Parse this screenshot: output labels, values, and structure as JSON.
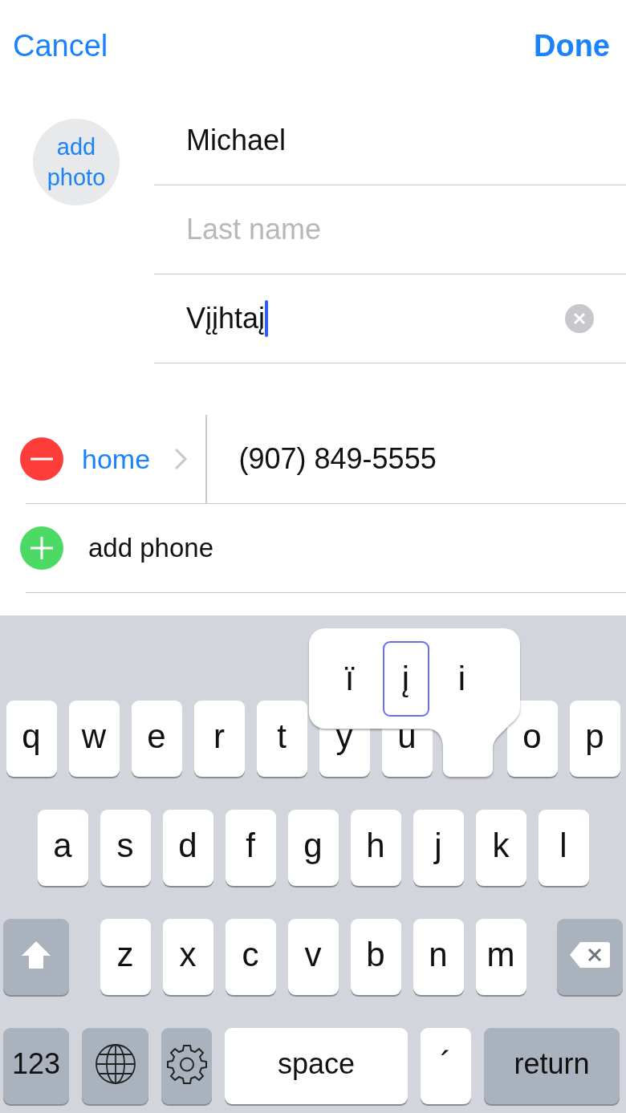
{
  "nav": {
    "cancel": "Cancel",
    "done": "Done"
  },
  "photo": {
    "label": "add photo"
  },
  "name_fields": [
    {
      "value": "Michael",
      "focused": false
    },
    {
      "placeholder": "Last name",
      "focused": false
    },
    {
      "value": "Vįįhtaį",
      "focused": true
    }
  ],
  "phones": [
    {
      "label": "home",
      "number": "(907) 849-5555"
    }
  ],
  "add_phone": "add phone",
  "keyboard": {
    "row_1": [
      {
        "kind": "letter",
        "label": "q"
      },
      {
        "kind": "letter",
        "label": "w"
      },
      {
        "kind": "letter",
        "label": "e"
      },
      {
        "kind": "letter",
        "label": "r"
      },
      {
        "kind": "letter",
        "label": "t"
      },
      {
        "kind": "letter",
        "label": "y"
      },
      {
        "kind": "letter",
        "label": "u"
      },
      {
        "kind": "letter",
        "label": "o"
      },
      {
        "kind": "letter",
        "label": "p"
      }
    ],
    "row_2": [
      {
        "kind": "letter",
        "label": "a"
      },
      {
        "kind": "letter",
        "label": "s"
      },
      {
        "kind": "letter",
        "label": "d"
      },
      {
        "kind": "letter",
        "label": "f"
      },
      {
        "kind": "letter",
        "label": "g"
      },
      {
        "kind": "letter",
        "label": "h"
      },
      {
        "kind": "letter",
        "label": "j"
      },
      {
        "kind": "letter",
        "label": "k"
      },
      {
        "kind": "letter",
        "label": "l"
      }
    ],
    "row_3": [
      {
        "kind": "shift"
      },
      {
        "kind": "letter",
        "label": "z"
      },
      {
        "kind": "letter",
        "label": "x"
      },
      {
        "kind": "letter",
        "label": "c"
      },
      {
        "kind": "letter",
        "label": "v"
      },
      {
        "kind": "letter",
        "label": "b"
      },
      {
        "kind": "letter",
        "label": "n"
      },
      {
        "kind": "letter",
        "label": "m"
      },
      {
        "kind": "delete"
      }
    ],
    "bottom_row": [
      {
        "kind": "mode",
        "label": "123"
      },
      {
        "kind": "globe"
      },
      {
        "kind": "gear"
      },
      {
        "kind": "space",
        "label": "space"
      },
      {
        "kind": "accent",
        "label": "´"
      },
      {
        "kind": "return",
        "label": "return"
      }
    ],
    "accent_popup": [
      {
        "label": "ï",
        "selected": false
      },
      {
        "label": "į",
        "selected": true
      },
      {
        "label": "i",
        "selected": false
      }
    ]
  }
}
